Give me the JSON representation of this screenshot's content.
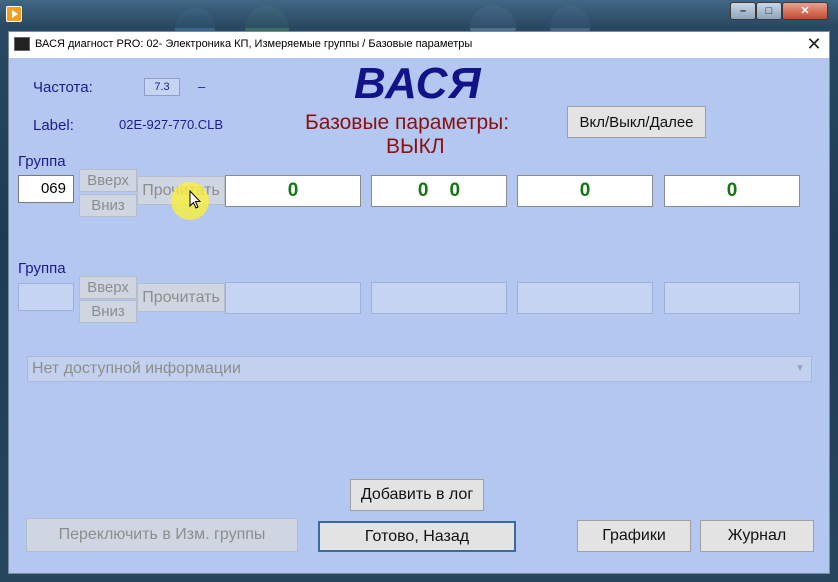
{
  "window": {
    "title": "ВАСЯ диагност PRO: 02- Электроника КП,  Измеряемые группы / Базовые параметры",
    "close_glyph": "✕"
  },
  "os_controls": {
    "minimize": "–",
    "maximize": "□",
    "close": "✕"
  },
  "header": {
    "freq_label": "Частота:",
    "freq_value": "7.3",
    "freq_dash": "–",
    "label_label": "Label:",
    "label_value": "02E-927-770.CLB",
    "brand": "ВАСЯ",
    "mode_title": "Базовые параметры:",
    "mode_state": "ВЫКЛ",
    "toggle_button": "Вкл/Выкл/Далее"
  },
  "group1": {
    "label": "Группа",
    "value": "069",
    "up": "Вверх",
    "down": "Вниз",
    "read": "Прочитать",
    "values": [
      "0",
      "0    0",
      "0",
      "0"
    ]
  },
  "group2": {
    "label": "Группа",
    "value": "",
    "up": "Вверх",
    "down": "Вниз",
    "read": "Прочитать",
    "values": [
      "",
      "",
      "",
      ""
    ]
  },
  "info": {
    "text": "Нет доступной информации",
    "arrow_icon": "chevron-down-icon"
  },
  "buttons": {
    "add_log": "Добавить в лог",
    "switch_groups": "Переключить в Изм. группы",
    "done_back": "Готово, Назад",
    "graphs": "Графики",
    "journal": "Журнал"
  },
  "colors": {
    "dialog_bg": "#b3c7f0",
    "brand": "#131388",
    "mode_text": "#8b1010",
    "value_text": "#127612"
  }
}
